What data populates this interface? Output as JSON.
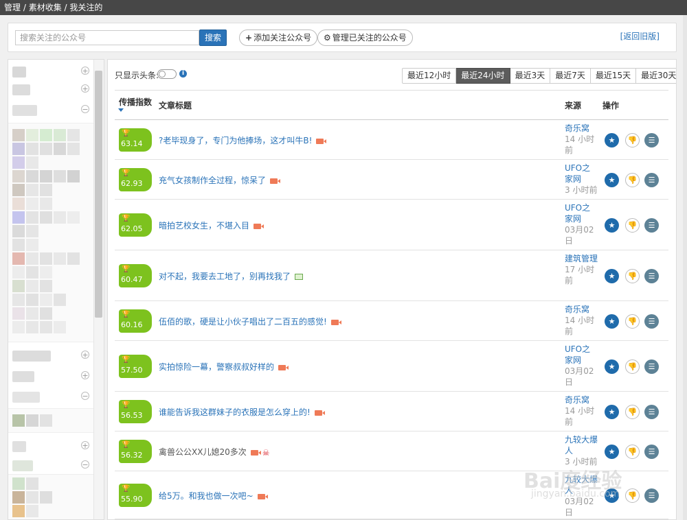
{
  "breadcrumb": {
    "items": [
      "管理",
      "素材收集",
      "我关注的"
    ],
    "separator": " / "
  },
  "search": {
    "placeholder": "搜索关注的公众号",
    "button_label": "搜索",
    "add_button_label": "添加关注公众号",
    "add_icon": "plus-icon",
    "manage_button_label": "管理已关注的公众号",
    "manage_icon": "gear-icon",
    "old_version_link": "[返回旧版]"
  },
  "filter": {
    "toggle_label": "只显示头条:",
    "toggle_on": false,
    "ranges": [
      "最近12小时",
      "最近24小时",
      "最近3天",
      "最近7天",
      "最近15天",
      "最近30天"
    ],
    "active_range": "最近24小时"
  },
  "table": {
    "headers": {
      "score": "传播指数",
      "title": "文章标题",
      "source": "来源",
      "actions": "操作"
    },
    "rows": [
      {
        "score": "63.14",
        "title": "?老毕现身了，专门为他捧场，这才叫牛B!",
        "tag": "video",
        "source_name": "奇乐窝",
        "source_time": "14 小时前"
      },
      {
        "score": "62.93",
        "title": "充气女孩制作全过程，惊呆了",
        "tag": "video",
        "source_name": "UFO之家网",
        "source_time": "3 小时前"
      },
      {
        "score": "62.05",
        "title": "暗拍艺校女生，不堪入目",
        "tag": "video",
        "source_name": "UFO之家网",
        "source_time": "03月02日"
      },
      {
        "score": "60.47",
        "title": "对不起，我要去工地了，别再找我了",
        "tag": "image",
        "source_name": "建筑管理",
        "source_time": "17 小时前"
      },
      {
        "score": "60.16",
        "title": "伍佰的歌，硬是让小伙子唱出了二百五的感觉!",
        "tag": "video",
        "source_name": "奇乐窝",
        "source_time": "14 小时前"
      },
      {
        "score": "57.50",
        "title": "实拍惊险一幕，警察叔叔好样的",
        "tag": "video",
        "source_name": "UFO之家网",
        "source_time": "03月02日"
      },
      {
        "score": "56.53",
        "title": "谁能告诉我这群妹子的衣服是怎么穿上的!",
        "tag": "video",
        "source_name": "奇乐窝",
        "source_time": "14 小时前"
      },
      {
        "score": "56.32",
        "title": "禽兽公公XX儿媳20多次",
        "tag": "video-skull",
        "source_name": "九较大爆人",
        "source_time": "3 小时前"
      },
      {
        "score": "55.90",
        "title": "给5万。和我也做一次吧~",
        "tag": "video",
        "source_name": "九较大爆人",
        "source_time": "03月02日"
      }
    ]
  },
  "icons": {
    "star": "star-icon",
    "dislike": "thumbs-down-icon",
    "list": "list-icon",
    "trophy": "trophy-icon",
    "info": "info-icon"
  },
  "colors": {
    "accent": "#2a73b8",
    "score_badge": "#7dc21e",
    "video_tag": "#ef7a57",
    "active_range": "#5c5c5c"
  },
  "watermark": {
    "main": "Bai度经验",
    "sub": "jingyan.baidu.com"
  }
}
